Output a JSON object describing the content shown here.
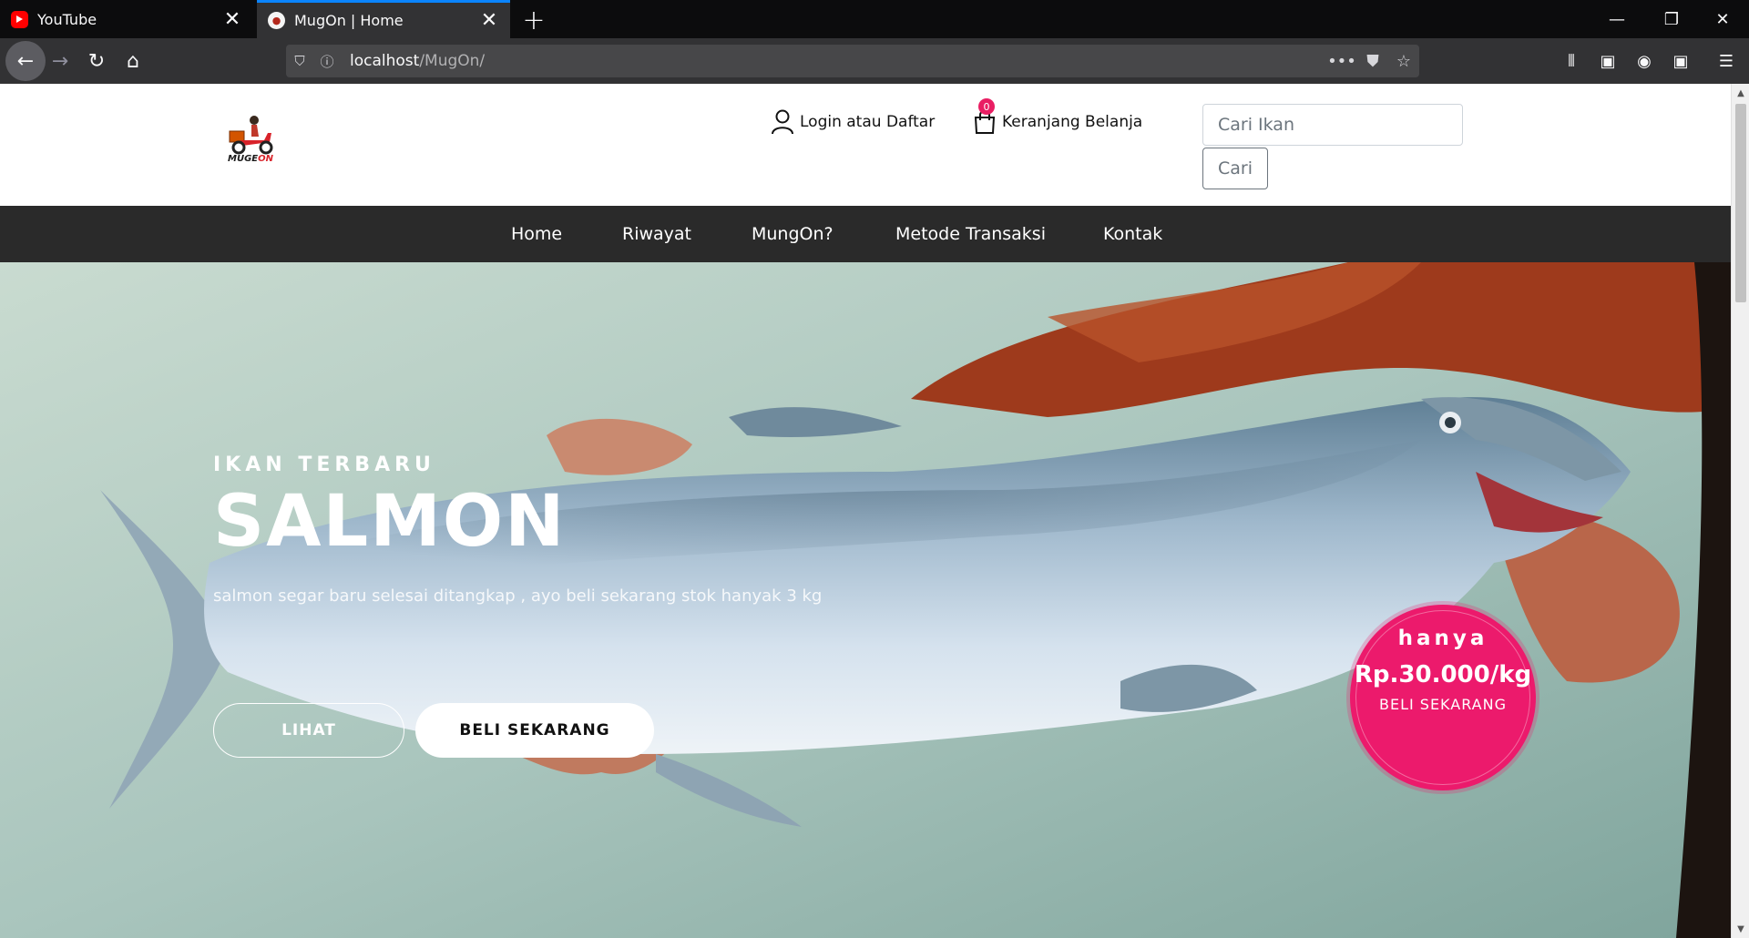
{
  "browser": {
    "tabs": [
      {
        "title": "YouTube",
        "icon": "youtube-icon",
        "active": false
      },
      {
        "title": "MugOn | Home",
        "icon": "mugon-favicon-icon",
        "active": true
      }
    ],
    "url": {
      "host": "localhost",
      "path": "/MugOn/"
    },
    "accent": "#0a84ff"
  },
  "site": {
    "logo": {
      "text_main": "MUGE",
      "text_accent": "ON"
    },
    "login_label": "Login atau Daftar",
    "cart_label": "Keranjang Belanja",
    "cart_count": "0",
    "search": {
      "placeholder": "Cari Ikan",
      "button": "Cari"
    },
    "menu": [
      "Home",
      "Riwayat",
      "MungOn?",
      "Metode Transaksi",
      "Kontak"
    ]
  },
  "hero": {
    "kicker": "IKAN TERBARU",
    "title": "SALMON",
    "description": "salmon segar baru selesai ditangkap , ayo beli sekarang stok hanyak 3 kg",
    "button_view": "LIHAT",
    "button_buy": "BELI SEKARANG",
    "badge": {
      "line1": "hanya",
      "price": "Rp.30.000/kg",
      "cta": "BELI SEKARANG",
      "color": "#ec1a6c"
    }
  }
}
